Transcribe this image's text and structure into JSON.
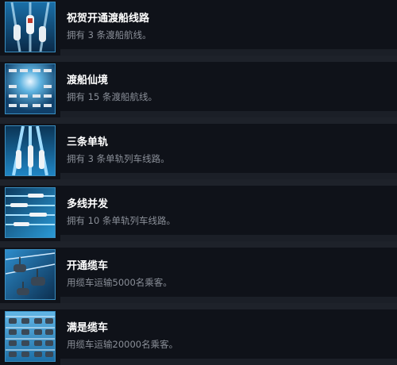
{
  "achievements": [
    {
      "title": "祝贺开通渡船线路",
      "description": "拥有 3 条渡船航线。",
      "icon": "ferry-lanes-icon"
    },
    {
      "title": "渡船仙境",
      "description": "拥有 15 条渡船航线。",
      "icon": "ferry-fleet-icon"
    },
    {
      "title": "三条单轨",
      "description": "拥有 3 条单轨列车线路。",
      "icon": "monorail-lines-icon"
    },
    {
      "title": "多线并发",
      "description": "拥有 10 条单轨列车线路。",
      "icon": "monorail-fleet-icon"
    },
    {
      "title": "开通缆车",
      "description": "用缆车运输5000名乘客。",
      "icon": "cable-car-icon"
    },
    {
      "title": "满是缆车",
      "description": "用缆车运输20000名乘客。",
      "icon": "cable-car-fleet-icon"
    }
  ],
  "colors": {
    "row_background": "#0f1219",
    "page_background": "#1e222a",
    "title": "#ffffff",
    "description": "#8a8f98",
    "icon_border": "#3a8ec0"
  }
}
